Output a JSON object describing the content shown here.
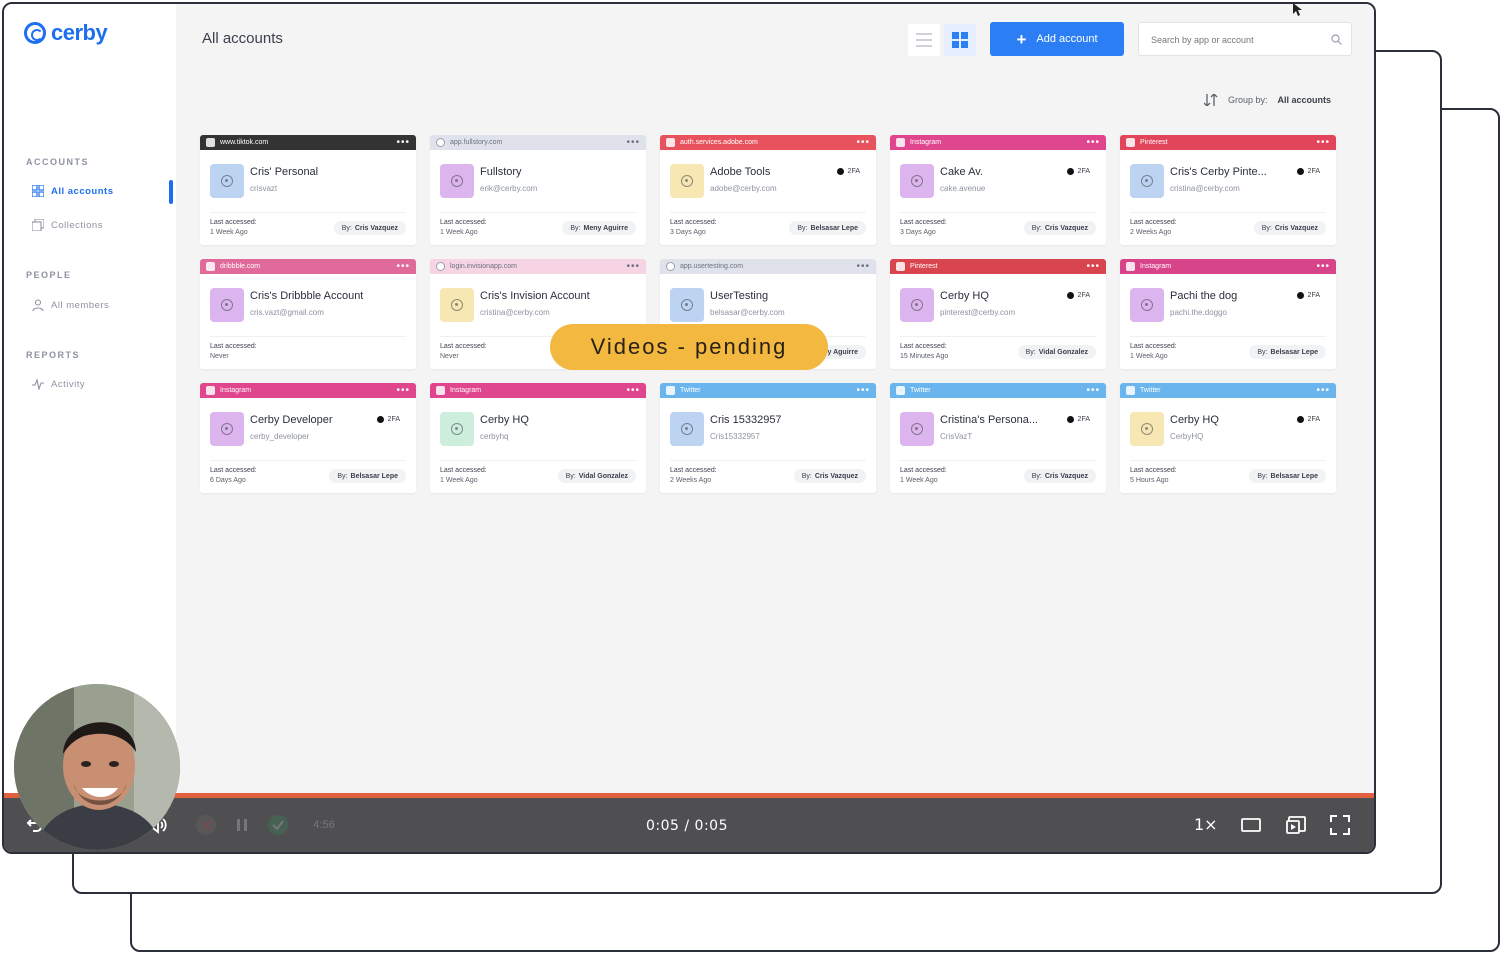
{
  "app": {
    "brand": "cerby",
    "page_title": "All accounts",
    "accent_color": "#2c7ef5"
  },
  "sidebar": {
    "sections": [
      {
        "heading": "ACCOUNTS",
        "items": [
          {
            "label": "All accounts",
            "icon": "grid-icon",
            "active": true
          },
          {
            "label": "Collections",
            "icon": "collections-icon",
            "active": false
          }
        ]
      },
      {
        "heading": "PEOPLE",
        "items": [
          {
            "label": "All members",
            "icon": "user-icon",
            "active": false
          }
        ]
      },
      {
        "heading": "REPORTS",
        "items": [
          {
            "label": "Activity",
            "icon": "activity-icon",
            "active": false
          }
        ]
      }
    ]
  },
  "toolbar": {
    "add_label": "Add account",
    "search_placeholder": "Search by app or account",
    "group_by_label": "Group by:",
    "group_by_value": "All accounts"
  },
  "accounts": [
    {
      "domain": "www.tiktok.com",
      "header_color": "#333333",
      "name": "Cris' Personal",
      "user": "crisvazt",
      "twofa": "",
      "last_label": "Last accessed:",
      "last": "1 Week Ago",
      "by": "Cris Vazquez",
      "avatar_color": "#bcd3f1"
    },
    {
      "domain": "app.fullstory.com",
      "header_color": "#dfe2ea",
      "light": true,
      "name": "Fullstory",
      "user": "erik@cerby.com",
      "twofa": "",
      "last_label": "Last accessed:",
      "last": "1 Week Ago",
      "by": "Meny Aguirre",
      "avatar_color": "#dcb5ee"
    },
    {
      "domain": "auth.services.adobe.com",
      "header_color": "#e8525d",
      "name": "Adobe Tools",
      "user": "adobe@cerby.com",
      "twofa": "2FA",
      "last_label": "Last accessed:",
      "last": "3 Days Ago",
      "by": "Belsasar Lepe",
      "avatar_color": "#f6e7b3"
    },
    {
      "domain": "Instagram",
      "header_color": "#e0468e",
      "name": "Cake Av.",
      "user": "cake.avenue",
      "twofa": "2FA",
      "last_label": "Last accessed:",
      "last": "3 Days Ago",
      "by": "Cris Vazquez",
      "avatar_color": "#dcb5ee"
    },
    {
      "domain": "Pinterest",
      "header_color": "#e2445a",
      "name": "Cris's Cerby Pinte...",
      "user": "cristina@cerby.com",
      "twofa": "2FA",
      "last_label": "Last accessed:",
      "last": "2 Weeks Ago",
      "by": "Cris Vazquez",
      "avatar_color": "#bcd3f1"
    },
    {
      "domain": "dribbble.com",
      "header_color": "#e06b9a",
      "name": "Cris's Dribbble Account",
      "user": "cris.vazt@gmail.com",
      "twofa": "",
      "last_label": "Last accessed:",
      "last": "Never",
      "by": "",
      "avatar_color": "#dcb5ee"
    },
    {
      "domain": "login.invisionapp.com",
      "header_color": "#f7d4e3",
      "light": true,
      "name": "Cris's Invision Account",
      "user": "cristina@cerby.com",
      "twofa": "",
      "last_label": "Last accessed:",
      "last": "Never",
      "by": "",
      "avatar_color": "#f6e7b3"
    },
    {
      "domain": "app.usertesting.com",
      "header_color": "#dfe2ea",
      "light": true,
      "name": "UserTesting",
      "user": "belsasar@cerby.com",
      "twofa": "",
      "last_label": "Last accessed:",
      "last": "",
      "by": "Meny Aguirre",
      "avatar_color": "#bcd3f1"
    },
    {
      "domain": "Pinterest",
      "header_color": "#d9454f",
      "name": "Cerby HQ",
      "user": "pinterest@cerby.com",
      "twofa": "2FA",
      "last_label": "Last accessed:",
      "last": "15 Minutes Ago",
      "by": "Vidal Gonzalez",
      "avatar_color": "#dcb5ee"
    },
    {
      "domain": "Instagram",
      "header_color": "#d7448a",
      "name": "Pachi the dog",
      "user": "pachi.the.doggo",
      "twofa": "2FA",
      "last_label": "Last accessed:",
      "last": "1 Week Ago",
      "by": "Belsasar Lepe",
      "avatar_color": "#dcb5ee"
    },
    {
      "domain": "Instagram",
      "header_color": "#e0468e",
      "name": "Cerby Developer",
      "user": "cerby_developer",
      "twofa": "2FA",
      "last_label": "Last accessed:",
      "last": "6 Days Ago",
      "by": "Belsasar Lepe",
      "avatar_color": "#dcb5ee"
    },
    {
      "domain": "Instagram",
      "header_color": "#e0468e",
      "name": "Cerby HQ",
      "user": "cerbyhq",
      "twofa": "",
      "last_label": "Last accessed:",
      "last": "1 Week Ago",
      "by": "Vidal Gonzalez",
      "avatar_color": "#cdeedd"
    },
    {
      "domain": "Twitter",
      "header_color": "#6ab5ee",
      "name": "Cris 15332957",
      "user": "Cris15332957",
      "twofa": "",
      "last_label": "Last accessed:",
      "last": "2 Weeks Ago",
      "by": "Cris Vazquez",
      "avatar_color": "#bcd3f1"
    },
    {
      "domain": "Twitter",
      "header_color": "#6ab5ee",
      "name": "Cristina's Persona...",
      "user": "CrisVazT",
      "twofa": "2FA",
      "last_label": "Last accessed:",
      "last": "1 Week Ago",
      "by": "Cris Vazquez",
      "avatar_color": "#dcb5ee"
    },
    {
      "domain": "Twitter",
      "header_color": "#6ab5ee",
      "name": "Cerby HQ",
      "user": "CerbyHQ",
      "twofa": "2FA",
      "last_label": "Last accessed:",
      "last": "5 Hours Ago",
      "by": "Belsasar Lepe",
      "avatar_color": "#f6e7b3"
    }
  ],
  "by_prefix": "By:",
  "overlay": {
    "pending_label": "Videos - pending",
    "pending_color": "#f2b83f"
  },
  "player": {
    "time": "0:05 / 0:05",
    "speed": "1×",
    "progress": 1.0,
    "progress_color": "#e1603f",
    "faded_label": "4:56"
  }
}
